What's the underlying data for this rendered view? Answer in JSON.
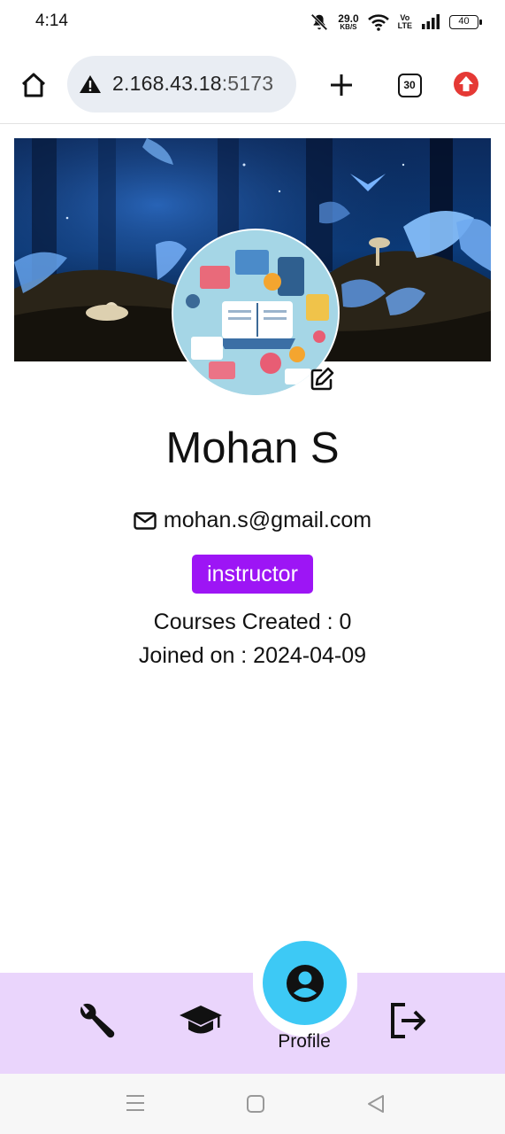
{
  "status_bar": {
    "time": "4:14",
    "net_speed_value": "29.0",
    "net_speed_unit": "KB/S",
    "volte_line1": "Vo",
    "volte_line2": "LTE",
    "battery": "40"
  },
  "browser": {
    "url_main": "2.168.43.18",
    "url_port": ":5173",
    "tab_count": "30",
    "icons": {
      "home": "home-icon",
      "warning": "warning-icon",
      "new_tab": "plus-icon",
      "update": "update-arrow-icon"
    },
    "update_color": "#e53935"
  },
  "profile": {
    "name": "Mohan S",
    "email": "mohan.s@gmail.com",
    "role": "instructor",
    "role_color": "#9d15f5",
    "courses_created": "Courses Created : 0",
    "joined_on": "Joined on : 2024-04-09"
  },
  "bottom_nav": {
    "items": [
      {
        "icon": "wrench-icon"
      },
      {
        "icon": "graduation-cap-icon"
      },
      {
        "icon": "profile-icon",
        "label": "Profile",
        "active": true
      },
      {
        "icon": "logout-icon"
      }
    ],
    "background": "#ead5fc",
    "active_color": "#3dc9f5"
  },
  "system_nav": {
    "icons": [
      "menu-icon",
      "home-square-icon",
      "back-triangle-icon"
    ]
  }
}
